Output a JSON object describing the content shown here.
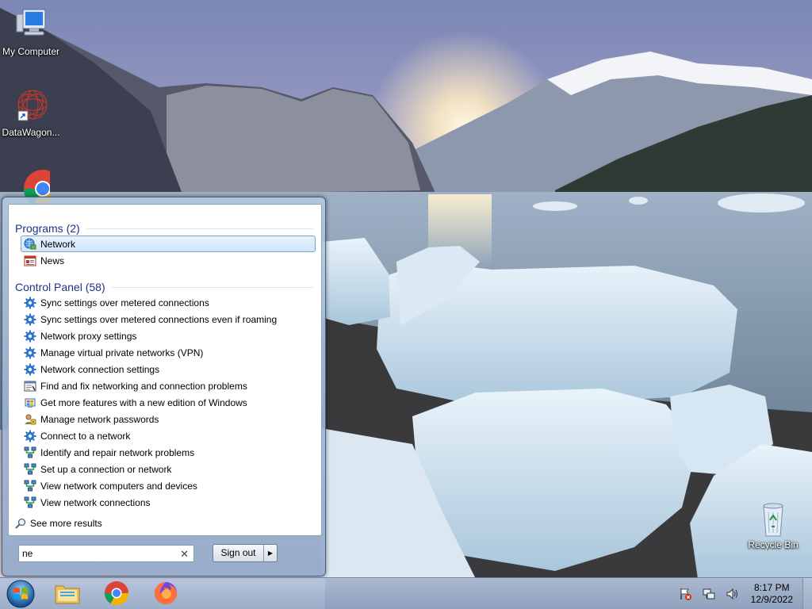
{
  "desktop": {
    "icons": [
      {
        "label": "My Computer"
      },
      {
        "label": "DataWagon..."
      },
      {
        "label": ""
      },
      {
        "label": "Recycle Bin"
      }
    ]
  },
  "start_menu": {
    "programs_header": "Programs (2)",
    "programs": [
      {
        "label": "Network",
        "icon": "network-icon",
        "selected": true
      },
      {
        "label": "News",
        "icon": "news-icon",
        "selected": false
      }
    ],
    "control_panel_header": "Control Panel (58)",
    "control_panel": [
      {
        "label": "Sync settings over metered connections",
        "icon": "gear-icon"
      },
      {
        "label": "Sync settings over metered connections even if roaming",
        "icon": "gear-icon"
      },
      {
        "label": "Network proxy settings",
        "icon": "gear-icon"
      },
      {
        "label": "Manage virtual private networks (VPN)",
        "icon": "gear-icon"
      },
      {
        "label": "Network connection settings",
        "icon": "gear-icon"
      },
      {
        "label": "Find and fix networking and connection problems",
        "icon": "troubleshoot-icon"
      },
      {
        "label": "Get more features with a new edition of Windows",
        "icon": "windows-flag-icon"
      },
      {
        "label": "Manage network passwords",
        "icon": "credentials-icon"
      },
      {
        "label": "Connect to a network",
        "icon": "gear-icon"
      },
      {
        "label": "Identify and repair network problems",
        "icon": "network-center-icon"
      },
      {
        "label": "Set up a connection or network",
        "icon": "network-center-icon"
      },
      {
        "label": "View network computers and devices",
        "icon": "network-center-icon"
      },
      {
        "label": "View network connections",
        "icon": "network-center-icon"
      }
    ],
    "see_more": "See more results",
    "search": {
      "value": "ne",
      "clear": "✕"
    },
    "signout_label": "Sign out",
    "signout_arrow": "▶"
  },
  "taskbar": {
    "pinned": [
      "explorer-icon",
      "chrome-icon",
      "firefox-icon"
    ],
    "tray": [
      "action-center-icon",
      "network-icon",
      "volume-icon"
    ],
    "clock_time": "8:17 PM",
    "clock_date": "12/9/2022"
  },
  "colors": {
    "section_header": "#1e3287",
    "selection_border": "#7da2ce"
  }
}
